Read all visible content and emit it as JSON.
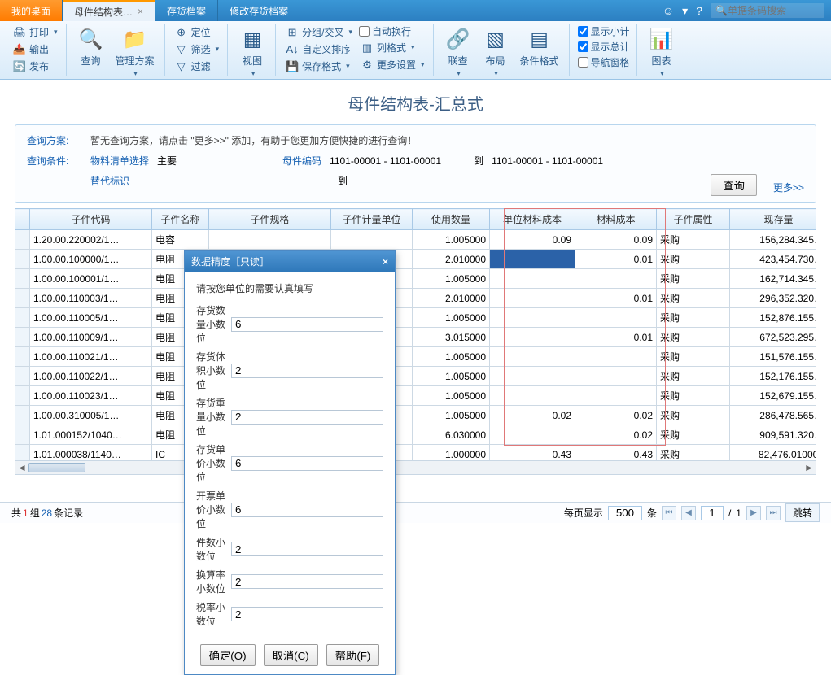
{
  "tabs": {
    "mydesk": "我的桌面",
    "current": "母件结构表…",
    "tab2": "存货档案",
    "tab3": "修改存货档案",
    "close_x": "×"
  },
  "search_placeholder": "单据条码搜索",
  "ribbon": {
    "print": "打印",
    "output": "输出",
    "publish": "发布",
    "query": "查询",
    "plan": "管理方案",
    "locate": "定位",
    "filter": "筛选",
    "filter2": "过滤",
    "view": "视图",
    "group": "分组/交叉",
    "custom_sort": "自定义排序",
    "save_fmt": "保存格式",
    "autowrap": "自动换行",
    "colfmt": "列格式",
    "moreset": "更多设置",
    "contact": "联查",
    "layout": "布局",
    "condfmt": "条件格式",
    "subtotal": "显示小计",
    "total": "显示总计",
    "navpane": "导航窗格",
    "chart": "图表"
  },
  "page_title": "母件结构表-汇总式",
  "query": {
    "plan_label": "查询方案:",
    "plan_text": "暂无查询方案，请点击 \"更多>>\" 添加，有助于您更加方便快捷的进行查询！",
    "cond_label": "查询条件:",
    "bom_sel_label": "物料清单选择",
    "bom_sel_val": "主要",
    "parent_label": "母件编码",
    "parent_val": "1101-00001 - 1101-00001",
    "to_label": "到",
    "to_val": "1101-00001 - 1101-00001",
    "sub_label": "替代标识",
    "to2_label": "到",
    "btn": "查询",
    "more": "更多>>"
  },
  "columns": [
    "子件代码",
    "子件名称",
    "子件规格",
    "子件计量单位",
    "使用数量",
    "单位材料成本",
    "材料成本",
    "子件属性",
    "现存量"
  ],
  "rows": [
    {
      "code": "1.20.00.220002/1…",
      "name": "电容",
      "qty": "1.005000",
      "ucost": "0.09",
      "cost": "0.09",
      "attr": "采购",
      "stock": "156,284.345…"
    },
    {
      "code": "1.00.00.100000/1…",
      "name": "电阻",
      "qty": "2.010000",
      "ucost": "",
      "cost": "0.01",
      "attr": "采购",
      "stock": "423,454.730…"
    },
    {
      "code": "1.00.00.100001/1…",
      "name": "电阻",
      "qty": "1.005000",
      "ucost": "",
      "cost": "",
      "attr": "采购",
      "stock": "162,714.345…"
    },
    {
      "code": "1.00.00.110003/1…",
      "name": "电阻",
      "qty": "2.010000",
      "ucost": "",
      "cost": "0.01",
      "attr": "采购",
      "stock": "296,352.320…"
    },
    {
      "code": "1.00.00.110005/1…",
      "name": "电阻",
      "qty": "1.005000",
      "ucost": "",
      "cost": "",
      "attr": "采购",
      "stock": "152,876.155…"
    },
    {
      "code": "1.00.00.110009/1…",
      "name": "电阻",
      "qty": "3.015000",
      "ucost": "",
      "cost": "0.01",
      "attr": "采购",
      "stock": "672,523.295…"
    },
    {
      "code": "1.00.00.110021/1…",
      "name": "电阻",
      "qty": "1.005000",
      "ucost": "",
      "cost": "",
      "attr": "采购",
      "stock": "151,576.155…"
    },
    {
      "code": "1.00.00.110022/1…",
      "name": "电阻",
      "qty": "1.005000",
      "ucost": "",
      "cost": "",
      "attr": "采购",
      "stock": "152,176.155…"
    },
    {
      "code": "1.00.00.110023/1…",
      "name": "电阻",
      "qty": "1.005000",
      "ucost": "",
      "cost": "",
      "attr": "采购",
      "stock": "152,679.155…"
    },
    {
      "code": "1.00.00.310005/1…",
      "name": "电阻",
      "qty": "1.005000",
      "ucost": "0.02",
      "cost": "0.02",
      "attr": "采购",
      "stock": "286,478.565…"
    },
    {
      "code": "1.01.000152/1040…",
      "name": "电阻",
      "qty": "6.030000",
      "ucost": "",
      "cost": "0.02",
      "attr": "采购",
      "stock": "909,591.320…"
    },
    {
      "code": "1.01.000038/1140…",
      "name": "IC",
      "qty": "1.000000",
      "ucost": "0.43",
      "cost": "0.43",
      "attr": "采购",
      "stock": "82,476.010000"
    }
  ],
  "status": {
    "total_prefix": "共 ",
    "groups": "1",
    "group_suffix": " 组  ",
    "records": "28",
    "rec_suffix": " 条记录",
    "page_label": "每页显示",
    "page_size": "500",
    "unit": "条",
    "page_cur": "1",
    "slash": "/",
    "page_total": "1",
    "jump": "跳转"
  },
  "dialog": {
    "title": "数据精度［只读］",
    "hint": "请按您单位的需要认真填写",
    "f1": "存货数量小数位",
    "v1": "6",
    "f2": "存货体积小数位",
    "v2": "2",
    "f3": "存货重量小数位",
    "v3": "2",
    "f4": "存货单价小数位",
    "v4": "6",
    "f5": "开票单价小数位",
    "v5": "6",
    "f6": "件数小数位",
    "v6": "2",
    "f7": "换算率小数位",
    "v7": "2",
    "f8": "税率小数位",
    "v8": "2",
    "ok": "确定(O)",
    "cancel": "取消(C)",
    "help": "帮助(F)"
  }
}
